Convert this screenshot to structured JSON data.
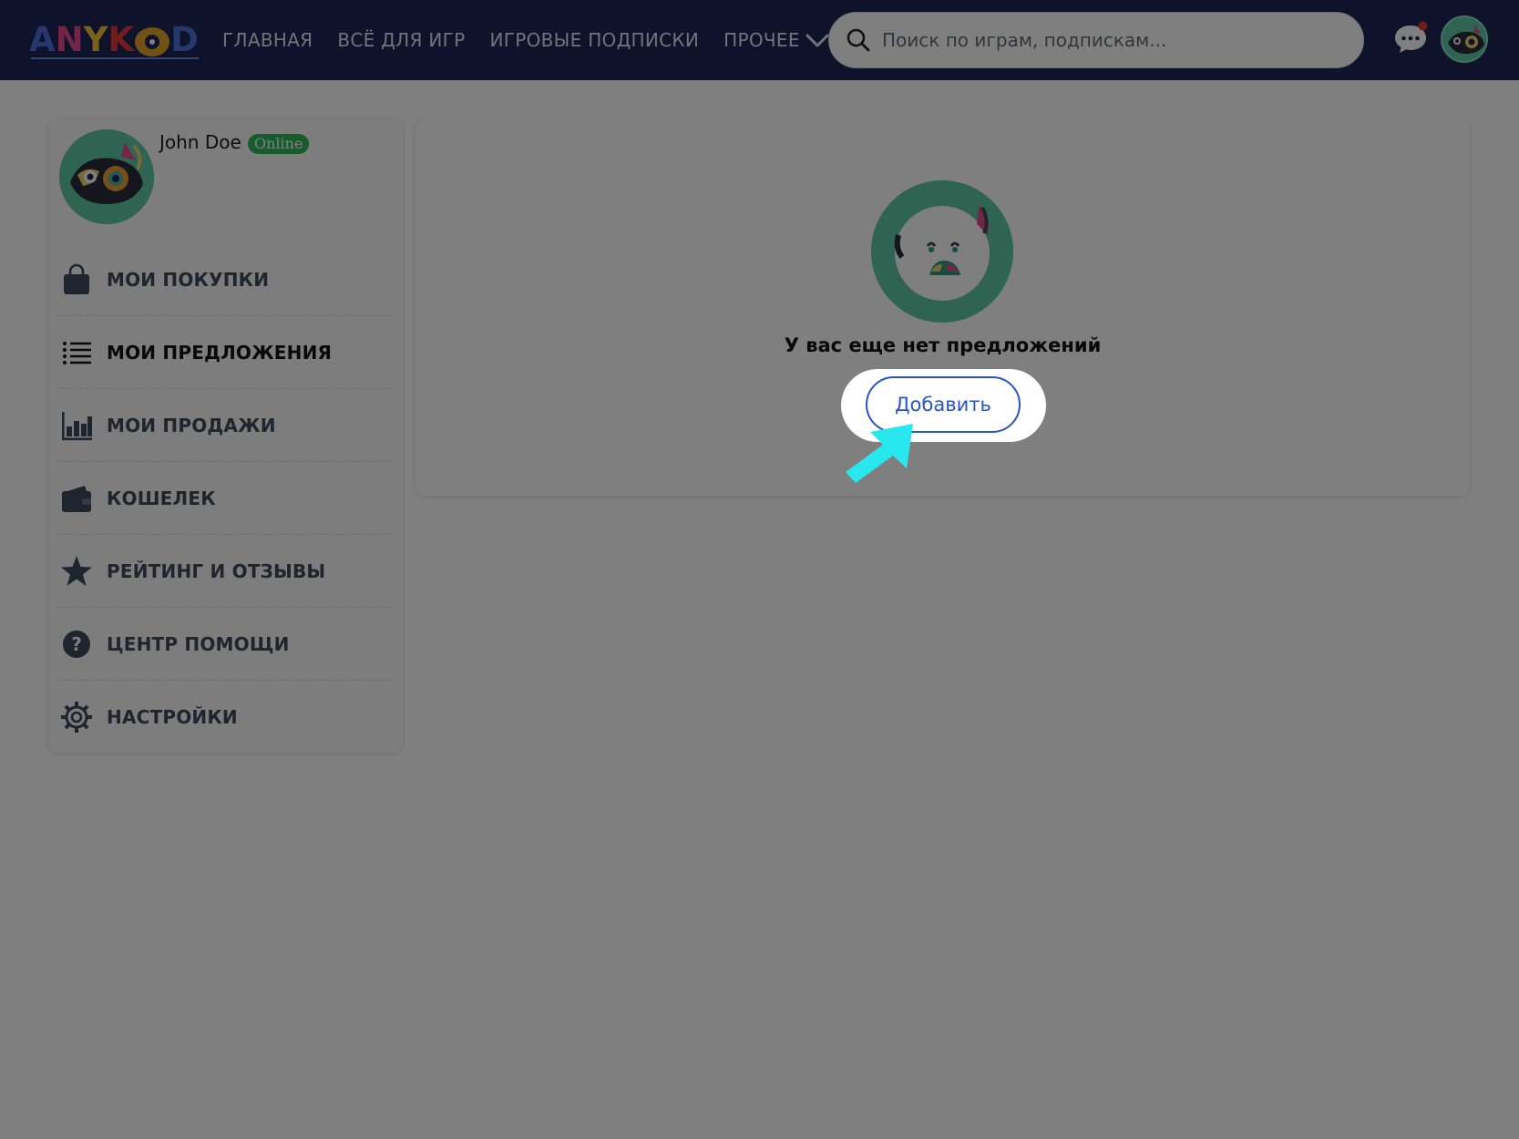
{
  "header": {
    "logo": {
      "letters": [
        "A",
        "N",
        "Y",
        "K",
        "D"
      ],
      "colors": [
        "#4a6fd8",
        "#e94a8a",
        "#f2c33a",
        "#e23a3a",
        "#4a6fd8"
      ]
    },
    "nav": [
      {
        "label": "ГЛАВНАЯ"
      },
      {
        "label": "ВСЁ ДЛЯ ИГР"
      },
      {
        "label": "ИГРОВЫЕ ПОДПИСКИ"
      },
      {
        "label": "ПРОЧЕЕ"
      }
    ],
    "search": {
      "placeholder": "Поиск по играм, подпискам..."
    },
    "chat_icon": "chat-bubble-icon",
    "notification_color": "#e53935"
  },
  "profile": {
    "name": "John Doe",
    "status": "Online"
  },
  "menu": [
    {
      "label": "МОИ ПОКУПКИ",
      "icon": "shopping-bag-icon",
      "active": false
    },
    {
      "label": "МОИ ПРЕДЛОЖЕНИЯ",
      "icon": "list-icon",
      "active": true
    },
    {
      "label": "МОИ ПРОДАЖИ",
      "icon": "bar-chart-icon",
      "active": false
    },
    {
      "label": "КОШЕЛЕК",
      "icon": "wallet-icon",
      "active": false
    },
    {
      "label": "РЕЙТИНГ И ОТЗЫВЫ",
      "icon": "star-icon",
      "active": false
    },
    {
      "label": "ЦЕНТР ПОМОЩИ",
      "icon": "help-icon",
      "active": false
    },
    {
      "label": "НАСТРОЙКИ",
      "icon": "gear-icon",
      "active": false
    }
  ],
  "content": {
    "empty_message": "У вас еще нет предложений",
    "add_button": "Добавить"
  },
  "colors": {
    "header_bg": "#1c2454",
    "accent": "#2a53c8",
    "avatar_bg": "#5ec9a5",
    "status_green": "#2fb85a",
    "pointer": "#28e8ee"
  }
}
